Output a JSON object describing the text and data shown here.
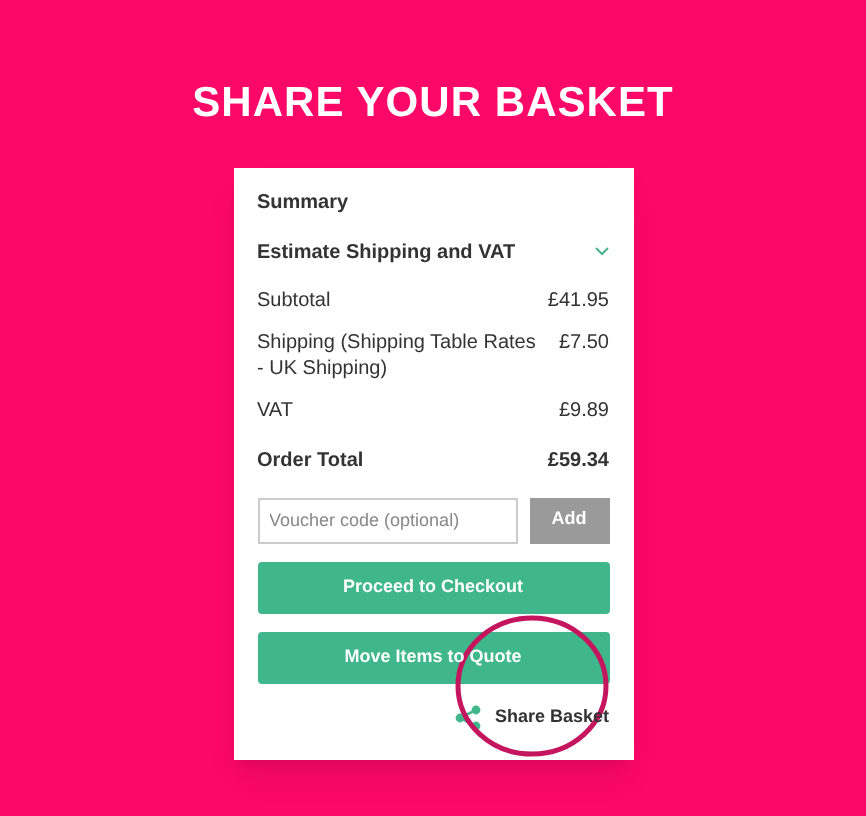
{
  "heading": "SHARE YOUR BASKET",
  "summary": {
    "title": "Summary",
    "estimate": {
      "label": "Estimate Shipping and VAT",
      "expanded": false
    },
    "rows": [
      {
        "label": "Subtotal",
        "value": "£41.95",
        "kind": "normal"
      },
      {
        "label": "Shipping (Shipping Table Rates - UK Shipping)",
        "value": "£7.50",
        "kind": "normal"
      },
      {
        "label": "VAT",
        "value": "£9.89",
        "kind": "normal"
      },
      {
        "label": "Order Total",
        "value": "£59.34",
        "kind": "total"
      }
    ],
    "voucher": {
      "placeholder": "Voucher code (optional)",
      "button": "Add"
    },
    "buttons": [
      "Proceed to Checkout",
      "Move Items to Quote"
    ],
    "share": "Share Basket"
  }
}
